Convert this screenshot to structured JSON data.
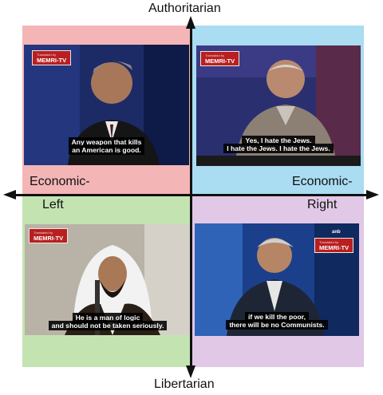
{
  "axes": {
    "top": "Authoritarian",
    "bottom": "Libertarian",
    "left_line1": "Economic-",
    "left_line2": "Left",
    "right_line1": "Economic-",
    "right_line2": "Right"
  },
  "colors": {
    "authoritarian_left": "#f4b5b6",
    "authoritarian_right": "#aadcf2",
    "libertarian_left": "#c3e4b1",
    "libertarian_right": "#e1c8e6"
  },
  "panels": [
    {
      "logo": "MEMRI-TV",
      "logo_small": "Translated by",
      "subtitle_line1": "Any weapon that kills",
      "subtitle_line2": "an American is good."
    },
    {
      "logo": "MEMRI-TV",
      "logo_small": "Translated by",
      "subtitle_line1": "Yes, I hate the Jews.",
      "subtitle_line2": "I hate the Jews. I hate the Jews."
    },
    {
      "logo": "MEMRI-TV",
      "logo_small": "Translated by",
      "subtitle_line1": "He is a man of logic",
      "subtitle_line2": "and should not be taken seriously."
    },
    {
      "logo": "MEMRI-TV",
      "logo_small": "Translated by",
      "channel": "anb",
      "subtitle_line1": "if we kill the poor,",
      "subtitle_line2": "there will be no Communists."
    }
  ]
}
